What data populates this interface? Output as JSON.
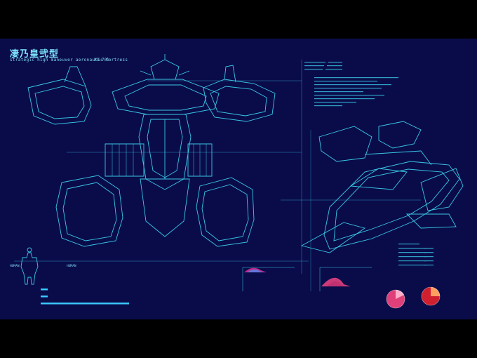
{
  "header": {
    "title": "凄乃皇弐型",
    "subtitle": "strategic high maneuver aeronautic fortress",
    "model": "XG-70b"
  },
  "scale_labels": {
    "left": "HUMAN",
    "right": "HUMAN"
  },
  "colors": {
    "background": "#0a0c4a",
    "line": "#39c8e6",
    "text": "#7fe6ff",
    "chart_pink": "#e0407a",
    "chart_red": "#d02030"
  }
}
